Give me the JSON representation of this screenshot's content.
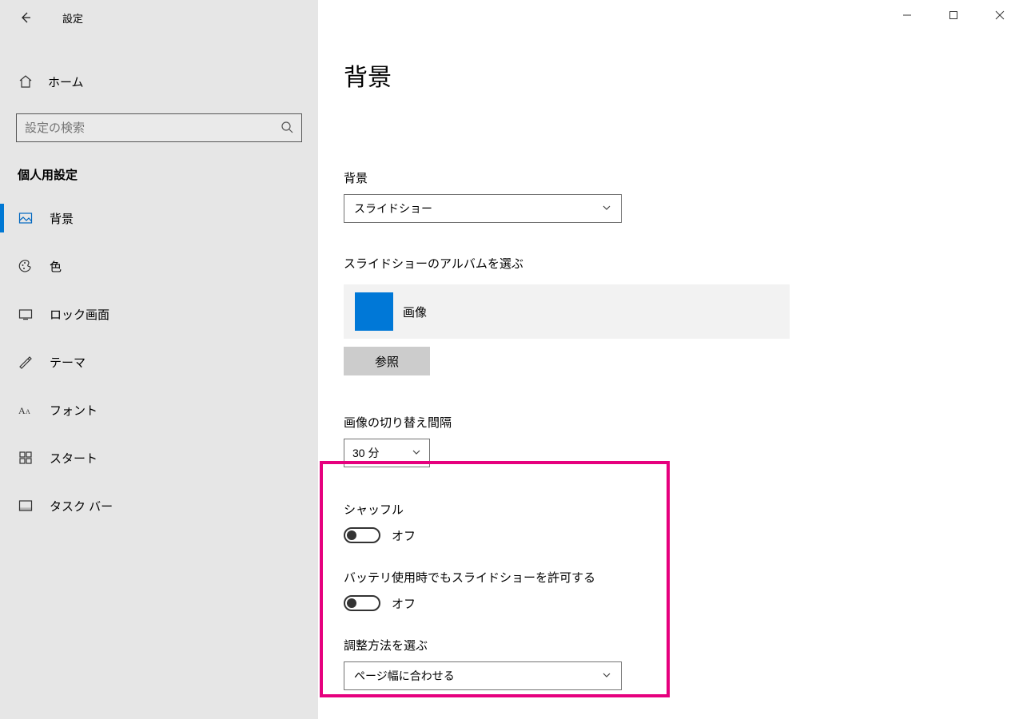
{
  "window": {
    "title": "設定"
  },
  "sidebar": {
    "home": "ホーム",
    "search_placeholder": "設定の検索",
    "category": "個人用設定",
    "items": [
      {
        "label": "背景"
      },
      {
        "label": "色"
      },
      {
        "label": "ロック画面"
      },
      {
        "label": "テーマ"
      },
      {
        "label": "フォント"
      },
      {
        "label": "スタート"
      },
      {
        "label": "タスク バー"
      }
    ]
  },
  "page": {
    "title": "背景",
    "bg_label": "背景",
    "bg_value": "スライドショー",
    "album_label": "スライドショーのアルバムを選ぶ",
    "album_value": "画像",
    "browse": "参照",
    "interval_label": "画像の切り替え間隔",
    "interval_value": "30 分",
    "shuffle_label": "シャッフル",
    "shuffle_state": "オフ",
    "battery_label": "バッテリ使用時でもスライドショーを許可する",
    "battery_state": "オフ",
    "fit_label": "調整方法を選ぶ",
    "fit_value": "ページ幅に合わせる"
  }
}
